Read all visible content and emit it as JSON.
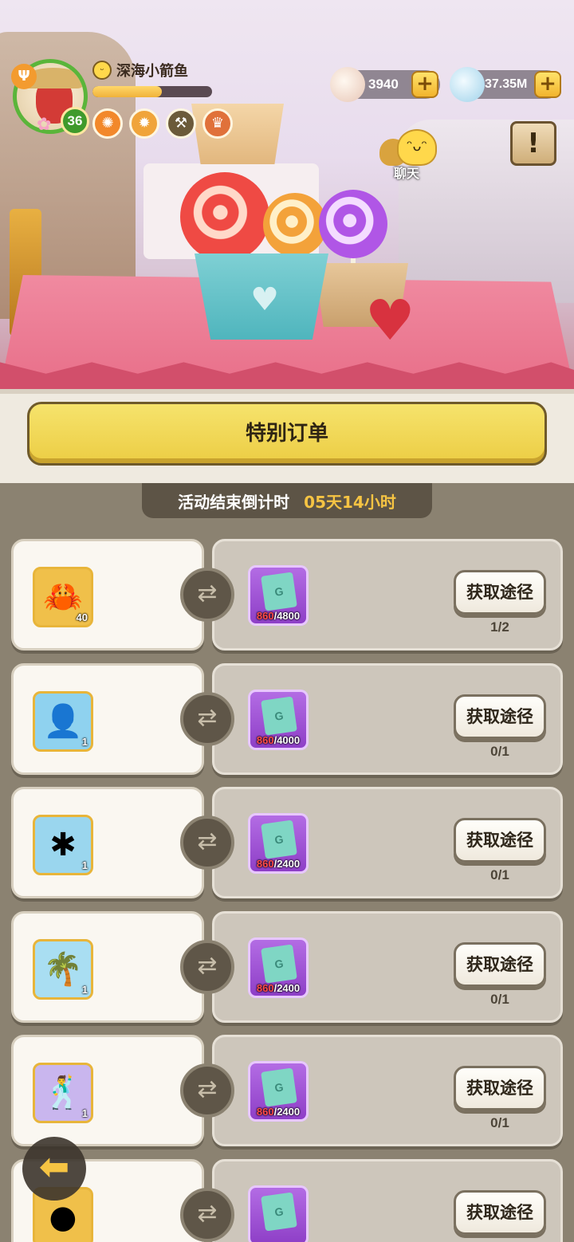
{
  "player": {
    "nickname": "深海小箭鱼",
    "level": "36",
    "xp_fraction": 0.58,
    "buffs": [
      {
        "icon": "sunflower-buff-icon",
        "color": "#f2882b"
      },
      {
        "icon": "lantern-buff-icon",
        "color": "#f0a43a"
      },
      {
        "icon": "shovel-buff-icon",
        "color": "#6b5a3a"
      },
      {
        "icon": "shield-buff-icon",
        "color": "#e0713a"
      }
    ]
  },
  "currencies": {
    "pearls": "3940",
    "stones": "37.35M"
  },
  "chat": {
    "label": "聊天"
  },
  "panel": {
    "title": "特别订单",
    "timer_label": "活动结束倒计时",
    "timer_value": "05天14小时",
    "get_button_label": "获取途径"
  },
  "orders": [
    {
      "item_icon": "crab-food-icon",
      "item_bg": "#f0c04a",
      "item_count": "40",
      "ticket_have": "860",
      "ticket_need": "/4800",
      "quota": "1/2"
    },
    {
      "item_icon": "silhouette-figure-icon",
      "item_bg": "#8fd2ef",
      "item_count": "1",
      "ticket_have": "860",
      "ticket_need": "/4000",
      "quota": "0/1"
    },
    {
      "item_icon": "starfish-icon",
      "item_bg": "#9ad6ee",
      "item_count": "1",
      "ticket_have": "860",
      "ticket_need": "/2400",
      "quota": "0/1"
    },
    {
      "item_icon": "palm-island-icon",
      "item_bg": "#a9def2",
      "item_count": "1",
      "ticket_have": "860",
      "ticket_need": "/2400",
      "quota": "0/1"
    },
    {
      "item_icon": "dancing-silhouette-icon",
      "item_bg": "#c9b6ee",
      "item_count": "1",
      "ticket_have": "860",
      "ticket_need": "/2400",
      "quota": "0/1"
    },
    {
      "item_icon": "dark-orb-icon",
      "item_bg": "#f0c04a",
      "item_count": "",
      "ticket_have": "",
      "ticket_need": "",
      "quota": ""
    }
  ]
}
